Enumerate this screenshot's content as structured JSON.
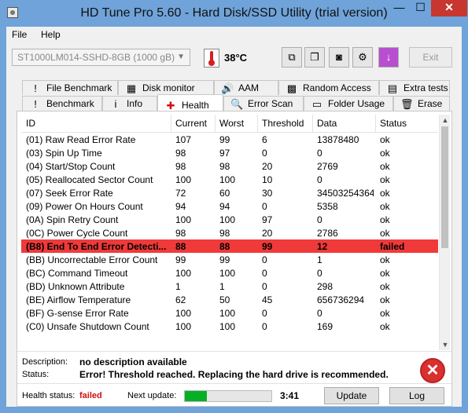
{
  "window": {
    "title": "HD Tune Pro 5.60 - Hard Disk/SSD Utility (trial version)",
    "min_glyph": "—",
    "max_glyph": "☐",
    "close_glyph": "✕"
  },
  "menu": {
    "file": "File",
    "help": "Help"
  },
  "toolbar": {
    "drive": "ST1000LM014-SSHD-8GB (1000 gB)",
    "temperature": "38°C",
    "exit_label": "Exit",
    "icons": [
      "copy-info-icon",
      "copy-screenshot-icon",
      "camera-icon",
      "options-icon",
      "save-icon"
    ]
  },
  "tabs_row1": [
    {
      "label": "File Benchmark",
      "icon": "!"
    },
    {
      "label": "Disk monitor",
      "icon": "▦"
    },
    {
      "label": "AAM",
      "icon": "🔊"
    },
    {
      "label": "Random Access",
      "icon": "▩"
    },
    {
      "label": "Extra tests",
      "icon": "▤"
    }
  ],
  "tabs_row2": [
    {
      "label": "Benchmark",
      "icon": "!"
    },
    {
      "label": "Info",
      "icon": "i"
    },
    {
      "label": "Health",
      "icon": "✚"
    },
    {
      "label": "Error Scan",
      "icon": "🔍"
    },
    {
      "label": "Folder Usage",
      "icon": "▭"
    },
    {
      "label": "Erase",
      "icon": "🗑"
    }
  ],
  "table": {
    "columns": [
      "ID",
      "Current",
      "Worst",
      "Threshold",
      "Data",
      "Status"
    ],
    "rows": [
      [
        "(01) Raw Read Error Rate",
        "107",
        "99",
        "6",
        "13878480",
        "ok"
      ],
      [
        "(03) Spin Up Time",
        "98",
        "97",
        "0",
        "0",
        "ok"
      ],
      [
        "(04) Start/Stop Count",
        "98",
        "98",
        "20",
        "2769",
        "ok"
      ],
      [
        "(05) Reallocated Sector Count",
        "100",
        "100",
        "10",
        "0",
        "ok"
      ],
      [
        "(07) Seek Error Rate",
        "72",
        "60",
        "30",
        "34503254364",
        "ok"
      ],
      [
        "(09) Power On Hours Count",
        "94",
        "94",
        "0",
        "5358",
        "ok"
      ],
      [
        "(0A) Spin Retry Count",
        "100",
        "100",
        "97",
        "0",
        "ok"
      ],
      [
        "(0C) Power Cycle Count",
        "98",
        "98",
        "20",
        "2786",
        "ok"
      ],
      [
        "(B8) End To End Error Detecti...",
        "88",
        "88",
        "99",
        "12",
        "failed"
      ],
      [
        "(BB) Uncorrectable Error Count",
        "99",
        "99",
        "0",
        "1",
        "ok"
      ],
      [
        "(BC) Command Timeout",
        "100",
        "100",
        "0",
        "0",
        "ok"
      ],
      [
        "(BD) Unknown Attribute",
        "1",
        "1",
        "0",
        "298",
        "ok"
      ],
      [
        "(BE) Airflow Temperature",
        "62",
        "50",
        "45",
        "656736294",
        "ok"
      ],
      [
        "(BF) G-sense Error Rate",
        "100",
        "100",
        "0",
        "0",
        "ok"
      ],
      [
        "(C0) Unsafe Shutdown Count",
        "100",
        "100",
        "0",
        "169",
        "ok"
      ]
    ],
    "failed_row_color": "#f03a3a"
  },
  "details": {
    "description_label": "Description:",
    "description_value": "no description available",
    "status_label": "Status:",
    "status_value": "Error! Threshold reached. Replacing the hard drive is recommended."
  },
  "statusbar": {
    "health_label": "Health status:",
    "health_value": "failed",
    "next_update_label": "Next update:",
    "next_update_time": "3:41",
    "progress_percent": 25,
    "update_label": "Update",
    "log_label": "Log"
  }
}
